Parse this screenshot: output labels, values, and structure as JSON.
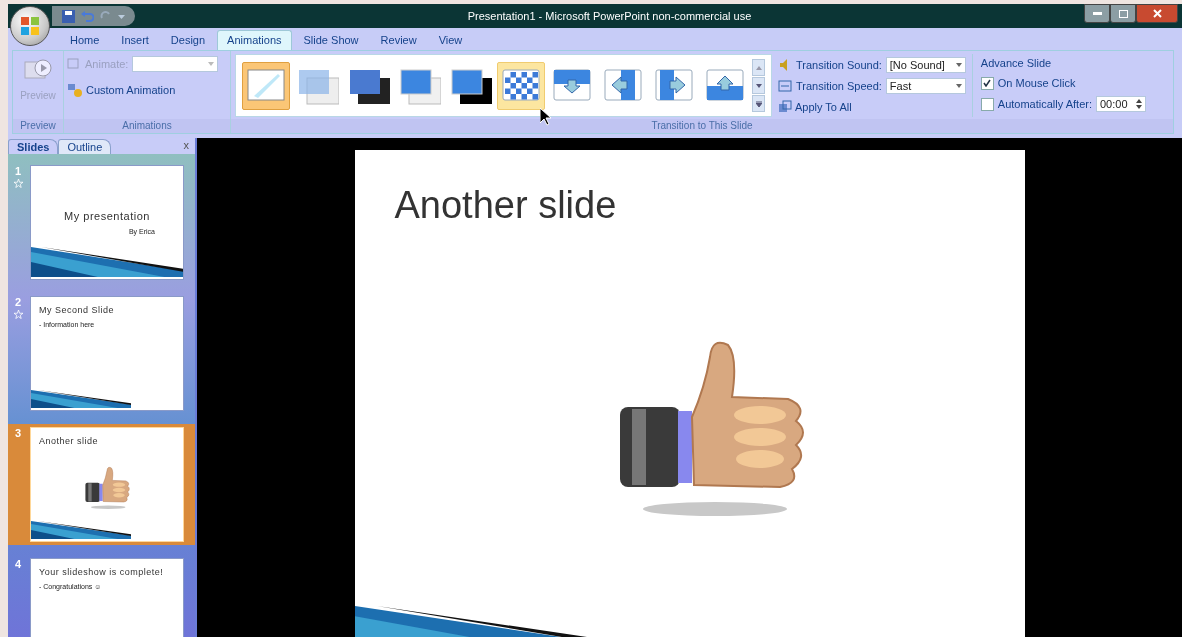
{
  "window": {
    "title": "Presentation1 - Microsoft PowerPoint non-commercial use"
  },
  "ribbon_tabs": [
    {
      "label": "Home",
      "selected": false
    },
    {
      "label": "Insert",
      "selected": false
    },
    {
      "label": "Design",
      "selected": false
    },
    {
      "label": "Animations",
      "selected": true
    },
    {
      "label": "Slide Show",
      "selected": false
    },
    {
      "label": "Review",
      "selected": false
    },
    {
      "label": "View",
      "selected": false
    }
  ],
  "preview_group": {
    "button": "Preview",
    "disabled": true,
    "label": "Preview"
  },
  "animations_group": {
    "animate_label": "Animate:",
    "animate_disabled": true,
    "custom_animation": "Custom Animation",
    "label": "Animations"
  },
  "transitions": [
    {
      "kind": "none",
      "selected": true,
      "hovered": false
    },
    {
      "kind": "fade",
      "selected": false,
      "hovered": false
    },
    {
      "kind": "fade-black",
      "selected": false,
      "hovered": false
    },
    {
      "kind": "cut",
      "selected": false,
      "hovered": false
    },
    {
      "kind": "cut-black",
      "selected": false,
      "hovered": false
    },
    {
      "kind": "dissolve",
      "selected": false,
      "hovered": true
    },
    {
      "kind": "down",
      "selected": false,
      "hovered": false
    },
    {
      "kind": "left",
      "selected": false,
      "hovered": false
    },
    {
      "kind": "right",
      "selected": false,
      "hovered": false
    },
    {
      "kind": "up",
      "selected": false,
      "hovered": false
    }
  ],
  "transition_group": {
    "label": "Transition to This Slide",
    "sound_label": "Transition Sound:",
    "sound_value": "[No Sound]",
    "speed_label": "Transition Speed:",
    "speed_value": "Fast",
    "apply_all": "Apply To All"
  },
  "advance_group": {
    "title": "Advance Slide",
    "on_click": {
      "label": "On Mouse Click",
      "checked": true
    },
    "after": {
      "label": "Automatically After:",
      "checked": false,
      "value": "00:00"
    }
  },
  "pane_tabs": [
    {
      "label": "Slides",
      "selected": true
    },
    {
      "label": "Outline",
      "selected": false
    }
  ],
  "pane_close": "x",
  "slides": [
    {
      "number": "1",
      "kind": "title",
      "title": "My presentation",
      "subtitle": "By Erica",
      "animated": true,
      "selected": false
    },
    {
      "number": "2",
      "kind": "content",
      "title": "My Second Slide",
      "bullet": "- Information here",
      "footer": true,
      "animated": true,
      "selected": false
    },
    {
      "number": "3",
      "kind": "picture",
      "title": "Another slide",
      "animated": false,
      "selected": true
    },
    {
      "number": "4",
      "kind": "content",
      "title": "Your slideshow is complete!",
      "bullet": "- Congratulations ☺",
      "animated": false,
      "selected": false
    }
  ],
  "current_slide": {
    "title": "Another slide"
  }
}
